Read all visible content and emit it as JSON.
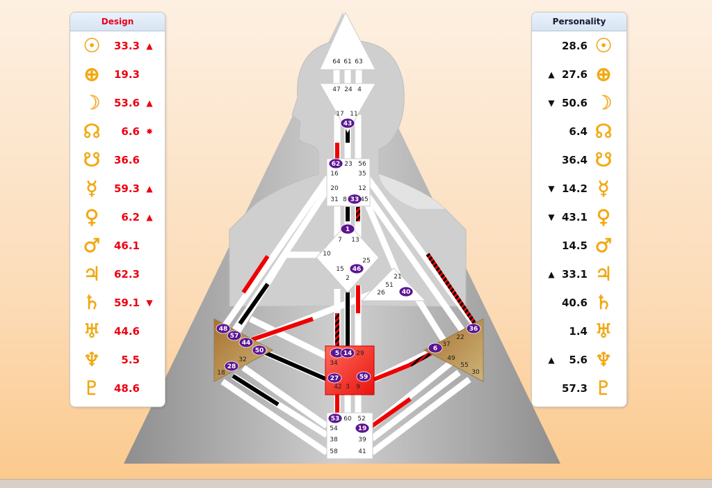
{
  "design": {
    "title": "Design",
    "color": "#ee0010",
    "rows": [
      {
        "planet": "sun-icon",
        "glyph": "☉",
        "value": "33.3",
        "mark": "▲"
      },
      {
        "planet": "earth-icon",
        "glyph": "⊕",
        "value": "19.3",
        "mark": ""
      },
      {
        "planet": "moon-icon",
        "glyph": "☽",
        "value": "53.6",
        "mark": "▲"
      },
      {
        "planet": "north-node-icon",
        "glyph": "☊",
        "value": "6.6",
        "mark": "✸"
      },
      {
        "planet": "south-node-icon",
        "glyph": "☋",
        "value": "36.6",
        "mark": ""
      },
      {
        "planet": "mercury-icon",
        "glyph": "☿",
        "value": "59.3",
        "mark": "▲"
      },
      {
        "planet": "venus-icon",
        "glyph": "♀",
        "value": "6.2",
        "mark": "▲"
      },
      {
        "planet": "mars-icon",
        "glyph": "♂",
        "value": "46.1",
        "mark": ""
      },
      {
        "planet": "jupiter-icon",
        "glyph": "♃",
        "value": "62.3",
        "mark": ""
      },
      {
        "planet": "saturn-icon",
        "glyph": "♄",
        "value": "59.1",
        "mark": "▼"
      },
      {
        "planet": "uranus-icon",
        "glyph": "♅",
        "value": "44.6",
        "mark": ""
      },
      {
        "planet": "neptune-icon",
        "glyph": "♆",
        "value": "5.5",
        "mark": ""
      },
      {
        "planet": "pluto-icon",
        "glyph": "♇",
        "value": "48.6",
        "mark": ""
      }
    ]
  },
  "personality": {
    "title": "Personality",
    "color": "#111111",
    "rows": [
      {
        "planet": "sun-icon",
        "glyph": "☉",
        "value": "28.6",
        "mark": ""
      },
      {
        "planet": "earth-icon",
        "glyph": "⊕",
        "value": "27.6",
        "mark": "▲"
      },
      {
        "planet": "moon-icon",
        "glyph": "☽",
        "value": "50.6",
        "mark": "▼"
      },
      {
        "planet": "north-node-icon",
        "glyph": "☊",
        "value": "6.4",
        "mark": ""
      },
      {
        "planet": "south-node-icon",
        "glyph": "☋",
        "value": "36.4",
        "mark": ""
      },
      {
        "planet": "mercury-icon",
        "glyph": "☿",
        "value": "14.2",
        "mark": "▼"
      },
      {
        "planet": "venus-icon",
        "glyph": "♀",
        "value": "43.1",
        "mark": "▼"
      },
      {
        "planet": "mars-icon",
        "glyph": "♂",
        "value": "14.5",
        "mark": ""
      },
      {
        "planet": "jupiter-icon",
        "glyph": "♃",
        "value": "33.1",
        "mark": "▲"
      },
      {
        "planet": "saturn-icon",
        "glyph": "♄",
        "value": "40.6",
        "mark": ""
      },
      {
        "planet": "uranus-icon",
        "glyph": "♅",
        "value": "1.4",
        "mark": ""
      },
      {
        "planet": "neptune-icon",
        "glyph": "♆",
        "value": "5.6",
        "mark": "▲"
      },
      {
        "planet": "pluto-icon",
        "glyph": "♇",
        "value": "57.3",
        "mark": ""
      }
    ]
  },
  "bodygraph": {
    "colors": {
      "design": "#ee0010",
      "personality": "#000000",
      "gate_active": "#5b1591",
      "sacral": "#f0302a",
      "spleen_solar": "#b98a4e"
    },
    "gates": {
      "head": [
        "64",
        "61",
        "63"
      ],
      "ajna": [
        "47",
        "24",
        "4",
        "17",
        "11",
        "43"
      ],
      "throat": [
        "62",
        "23",
        "56",
        "16",
        "35",
        "20",
        "12",
        "31",
        "8",
        "33",
        "45"
      ],
      "g": [
        "1",
        "7",
        "13",
        "10",
        "25",
        "15",
        "46",
        "2"
      ],
      "heart": [
        "21",
        "51",
        "26",
        "40"
      ],
      "spleen": [
        "48",
        "57",
        "44",
        "50",
        "32",
        "28",
        "18"
      ],
      "sacral": [
        "5",
        "14",
        "29",
        "34",
        "27",
        "59",
        "42",
        "3",
        "9"
      ],
      "solar_plexus": [
        "36",
        "22",
        "37",
        "6",
        "49",
        "55",
        "30"
      ],
      "root": [
        "53",
        "60",
        "52",
        "54",
        "19",
        "38",
        "39",
        "58",
        "41"
      ]
    }
  }
}
